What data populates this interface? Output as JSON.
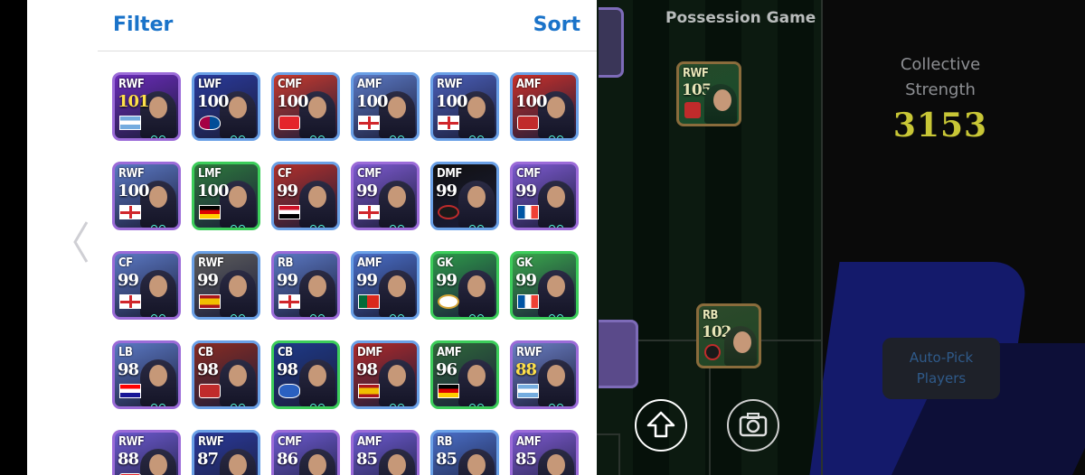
{
  "panel": {
    "filter_label": "Filter",
    "sort_label": "Sort"
  },
  "cards": [
    {
      "pos": "RWF",
      "ovr": "101",
      "flag": "argentina",
      "bg": "#6a2bb8",
      "rim": "purple",
      "gold": true
    },
    {
      "pos": "LWF",
      "ovr": "100",
      "flag": "barcelona",
      "bg": "#2a3a9c",
      "rim": "blue",
      "gold": false
    },
    {
      "pos": "CMF",
      "ovr": "100",
      "flag": "arsenal",
      "bg": "#c83a2e",
      "rim": "blue",
      "gold": false
    },
    {
      "pos": "AMF",
      "ovr": "100",
      "flag": "england",
      "bg": "#5b79c4",
      "rim": "blue",
      "gold": false
    },
    {
      "pos": "RWF",
      "ovr": "100",
      "flag": "england",
      "bg": "#4a5fb8",
      "rim": "blue",
      "gold": false
    },
    {
      "pos": "AMF",
      "ovr": "100",
      "flag": "epic-badge",
      "bg": "#c9302a",
      "rim": "blue",
      "gold": false
    },
    {
      "pos": "RWF",
      "ovr": "100",
      "flag": "england",
      "bg": "#5b79c4",
      "rim": "purple",
      "gold": false
    },
    {
      "pos": "LMF",
      "ovr": "100",
      "flag": "germany",
      "bg": "#2e7a3c",
      "rim": "green",
      "gold": false
    },
    {
      "pos": "CF",
      "ovr": "99",
      "flag": "egypt",
      "bg": "#b3302b",
      "rim": "blue",
      "gold": false
    },
    {
      "pos": "CMF",
      "ovr": "99",
      "flag": "england",
      "bg": "#7d5ad0",
      "rim": "purple",
      "gold": false
    },
    {
      "pos": "DMF",
      "ovr": "99",
      "flag": "milan",
      "bg": "#111111",
      "rim": "blue",
      "gold": false
    },
    {
      "pos": "CMF",
      "ovr": "99",
      "flag": "france",
      "bg": "#7d5ad0",
      "rim": "purple",
      "gold": false
    },
    {
      "pos": "CF",
      "ovr": "99",
      "flag": "england",
      "bg": "#5b79c4",
      "rim": "purple",
      "gold": false
    },
    {
      "pos": "RWF",
      "ovr": "99",
      "flag": "spain",
      "bg": "#5d5d5d",
      "rim": "blue",
      "gold": false
    },
    {
      "pos": "RB",
      "ovr": "99",
      "flag": "england",
      "bg": "#5b79c4",
      "rim": "purple",
      "gold": false
    },
    {
      "pos": "AMF",
      "ovr": "99",
      "flag": "portugal",
      "bg": "#4a6fc8",
      "rim": "blue",
      "gold": false
    },
    {
      "pos": "GK",
      "ovr": "99",
      "flag": "real-madrid",
      "bg": "#2e9a4a",
      "rim": "green",
      "gold": false
    },
    {
      "pos": "GK",
      "ovr": "99",
      "flag": "france",
      "bg": "#3aa84c",
      "rim": "green",
      "gold": false
    },
    {
      "pos": "LB",
      "ovr": "98",
      "flag": "croatia",
      "bg": "#5b79c4",
      "rim": "purple",
      "gold": false
    },
    {
      "pos": "CB",
      "ovr": "98",
      "flag": "epic-badge",
      "bg": "#8a2c22",
      "rim": "blue",
      "gold": false
    },
    {
      "pos": "CB",
      "ovr": "98",
      "flag": "club-crest",
      "bg": "#1e3a8a",
      "rim": "green",
      "gold": false
    },
    {
      "pos": "DMF",
      "ovr": "98",
      "flag": "spain",
      "bg": "#b02a2a",
      "rim": "blue",
      "gold": false
    },
    {
      "pos": "AMF",
      "ovr": "96",
      "flag": "germany",
      "bg": "#2f6a3a",
      "rim": "green",
      "gold": false
    },
    {
      "pos": "RWF",
      "ovr": "88",
      "flag": "argentina",
      "bg": "#6b7fc4",
      "rim": "purple",
      "gold": true
    },
    {
      "pos": "RWF",
      "ovr": "88",
      "flag": "arsenal",
      "bg": "#6d5ad0",
      "rim": "purple",
      "gold": false
    },
    {
      "pos": "RWF",
      "ovr": "87",
      "flag": "none",
      "bg": "#2a3a9c",
      "rim": "blue",
      "gold": false
    },
    {
      "pos": "CMF",
      "ovr": "86",
      "flag": "none",
      "bg": "#6d5ad0",
      "rim": "purple",
      "gold": false
    },
    {
      "pos": "AMF",
      "ovr": "85",
      "flag": "none",
      "bg": "#6d5ad0",
      "rim": "purple",
      "gold": false
    },
    {
      "pos": "RB",
      "ovr": "85",
      "flag": "none",
      "bg": "#4a6fc8",
      "rim": "blue",
      "gold": false
    },
    {
      "pos": "AMF",
      "ovr": "85",
      "flag": "none",
      "bg": "#7d5ad0",
      "rim": "purple",
      "gold": false
    }
  ],
  "pitch": {
    "title": "Possession Game",
    "card_rwf": {
      "pos": "RWF",
      "ovr": "105"
    },
    "card_rb": {
      "pos": "RB",
      "ovr": "102"
    }
  },
  "sidebar": {
    "strength_line1": "Collective",
    "strength_line2": "Strength",
    "strength_value": "3153",
    "autopick_line1": "Auto-Pick",
    "autopick_line2": "Players"
  },
  "icons": {
    "back": "chevron-left-icon",
    "upload": "arrow-up-icon",
    "camera": "camera-icon"
  },
  "colors": {
    "accent_blue": "#1a73c9",
    "strength_yellow": "#c8c636"
  }
}
